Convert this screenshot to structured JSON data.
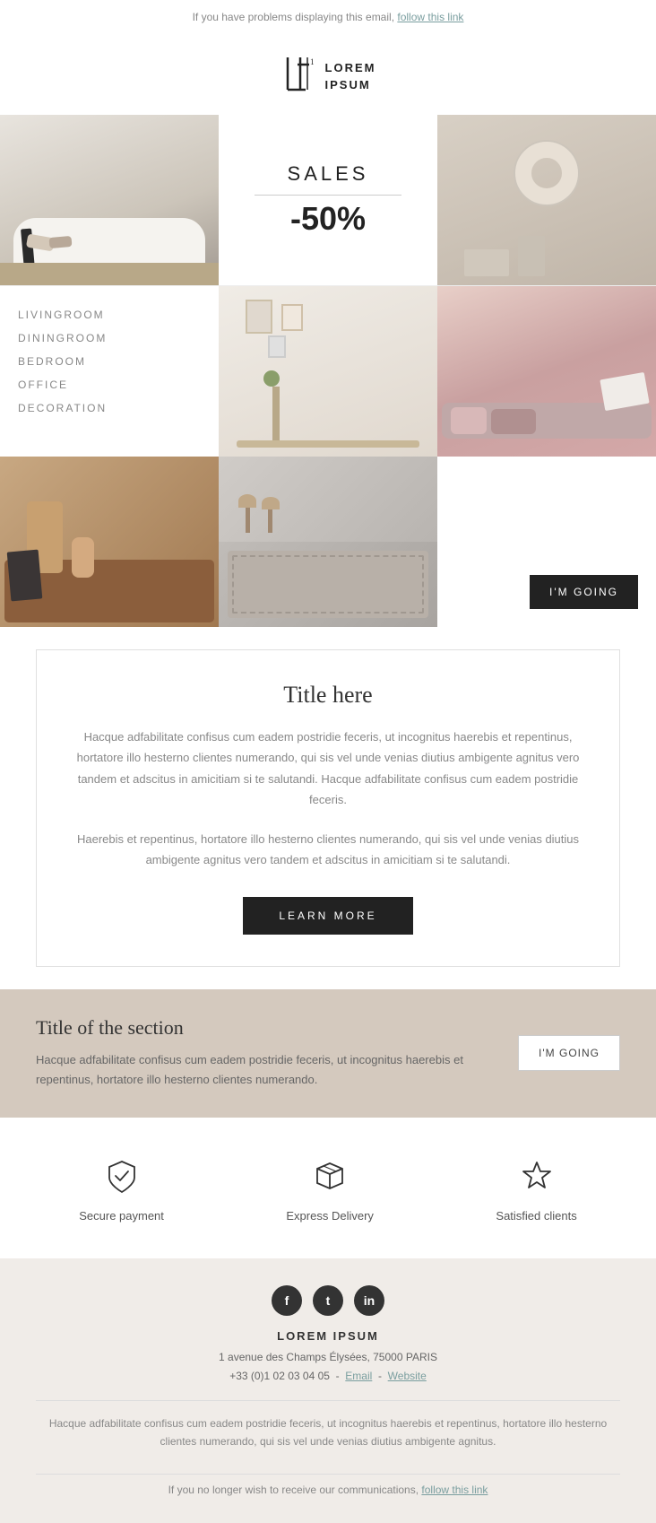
{
  "topbar": {
    "text": "If you have problems displaying this email,",
    "link_text": "follow this link"
  },
  "logo": {
    "icon": "L₁",
    "line1": "LOREM",
    "line2": "IPSUM"
  },
  "hero": {
    "sales_label": "SALES",
    "sales_percent": "-50%"
  },
  "nav": {
    "items": [
      {
        "label": "LIVINGROOM"
      },
      {
        "label": "DININGROOM"
      },
      {
        "label": "BEDROOM"
      },
      {
        "label": "OFFICE"
      },
      {
        "label": "DECORATION"
      }
    ]
  },
  "cta": {
    "im_going": "I'M GOING",
    "learn_more": "LEARN MORE"
  },
  "text_section": {
    "title": "Title here",
    "body1": "Hacque adfabilitate confisus cum eadem postridie feceris, ut incognitus haerebis et repentinus, hortatore illo hesterno clientes numerando, qui sis vel unde venias diutius ambigente agnitus vero tandem et adscitus in amicitiam si te salutandi. Hacque adfabilitate confisus cum eadem postridie feceris.",
    "body2": "Haerebis et repentinus, hortatore illo hesterno clientes numerando, qui sis vel unde venias diutius ambigente agnitus vero tandem et adscitus in amicitiam si te salutandi."
  },
  "beige_section": {
    "title": "Title of the section",
    "body": "Hacque adfabilitate confisus cum eadem postridie feceris, ut incognitus haerebis et repentinus, hortatore illo hesterno clientes numerando.",
    "btn": "I'M GOING"
  },
  "features": [
    {
      "id": "secure-payment",
      "icon": "shield-check",
      "label": "Secure payment"
    },
    {
      "id": "express-delivery",
      "icon": "box",
      "label": "Express Delivery"
    },
    {
      "id": "satisfied-clients",
      "icon": "star",
      "label": "Satisfied clients"
    }
  ],
  "footer": {
    "social": [
      {
        "id": "facebook",
        "symbol": "f"
      },
      {
        "id": "twitter",
        "symbol": "t"
      },
      {
        "id": "instagram",
        "symbol": "in"
      }
    ],
    "brand": "LOREM IPSUM",
    "address": "1 avenue des Champs Élysées, 75000 PARIS",
    "phone": "+33 (0)1 02 03 04 05",
    "email_label": "Email",
    "website_label": "Website",
    "body_text": "Hacque adfabilitate confisus cum eadem postridie feceris, ut incognitus haerebis et repentinus, hortatore illo hesterno clientes numerando, qui sis vel unde venias diutius ambigente agnitus.",
    "unsubscribe_text": "If you no longer wish to receive our communications,",
    "unsubscribe_link": "follow this link"
  }
}
